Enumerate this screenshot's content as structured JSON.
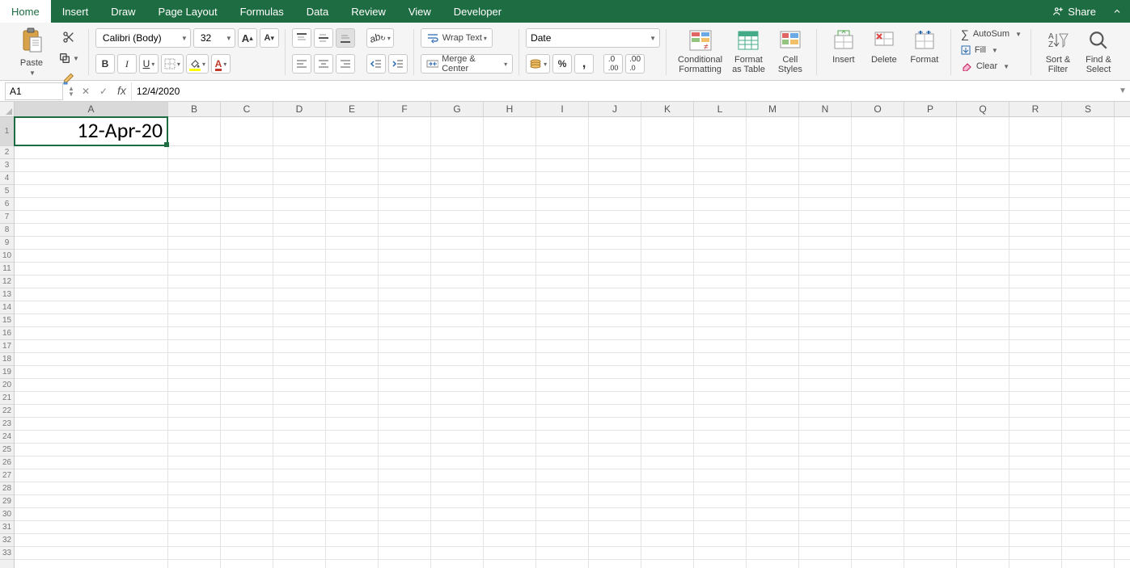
{
  "tabs": [
    "Home",
    "Insert",
    "Draw",
    "Page Layout",
    "Formulas",
    "Data",
    "Review",
    "View",
    "Developer"
  ],
  "active_tab": 0,
  "share_label": "Share",
  "ribbon": {
    "paste_label": "Paste",
    "font_name": "Calibri (Body)",
    "font_size": "32",
    "wrap_text_label": "Wrap Text",
    "merge_label": "Merge & Center",
    "number_format": "Date",
    "cond_fmt_label": "Conditional\nFormatting",
    "fmt_table_label": "Format\nas Table",
    "cell_styles_label": "Cell\nStyles",
    "insert_label": "Insert",
    "delete_label": "Delete",
    "format_label": "Format",
    "autosum_label": "AutoSum",
    "fill_label": "Fill",
    "clear_label": "Clear",
    "sort_label": "Sort &\nFilter",
    "find_label": "Find &\nSelect"
  },
  "formula_bar": {
    "name_box": "A1",
    "formula": "12/4/2020"
  },
  "columns": [
    "A",
    "B",
    "C",
    "D",
    "E",
    "F",
    "G",
    "H",
    "I",
    "J",
    "K",
    "L",
    "M",
    "N",
    "O",
    "P",
    "Q",
    "R",
    "S"
  ],
  "col_widths": {
    "A": 190,
    "default": 65
  },
  "row_heights": {
    "1": 36,
    "default": 16
  },
  "num_rows": 33,
  "selection": {
    "cell": "A1",
    "row": 1,
    "col": "A"
  },
  "cell_values": {
    "A1": "12-Apr-20"
  }
}
